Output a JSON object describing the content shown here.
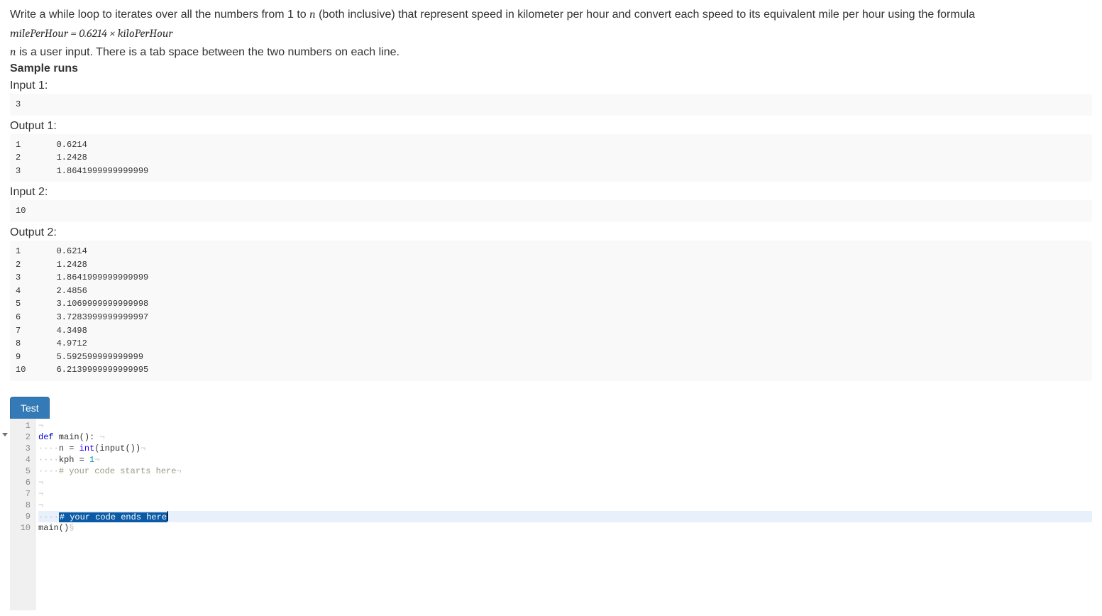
{
  "problem": {
    "line1_prefix": "Write a while loop to iterates over all the numbers from 1 to ",
    "var_n": "n",
    "line1_suffix": " (both inclusive) that represent speed in kilometer per hour and convert each speed to its equivalent mile per hour using the formula",
    "formula": "milePerHour = 0.6214 × kiloPerHour",
    "line3_prefix_n": "n",
    "line3_rest": " is a user input. There is a tab space between the two numbers on each line.",
    "sample_runs_label": "Sample runs",
    "input1_label": "Input 1:",
    "input1": "3",
    "output1_label": "Output 1:",
    "output1": "1\t0.6214\n2\t1.2428\n3\t1.8641999999999999",
    "input2_label": "Input 2:",
    "input2": "10",
    "output2_label": "Output 2:",
    "output2": "1\t0.6214\n2\t1.2428\n3\t1.8641999999999999\n4\t2.4856\n5\t3.1069999999999998\n6\t3.7283999999999997\n7\t4.3498\n8\t4.9712\n9\t5.592599999999999\n10\t6.2139999999999995"
  },
  "tabs": {
    "test": "Test"
  },
  "editor": {
    "lines": [
      {
        "num": "1",
        "kind": "blank"
      },
      {
        "num": "2",
        "kind": "def",
        "fold": true
      },
      {
        "num": "3",
        "kind": "assign_input"
      },
      {
        "num": "4",
        "kind": "assign_kph"
      },
      {
        "num": "5",
        "kind": "comment_start"
      },
      {
        "num": "6",
        "kind": "blank"
      },
      {
        "num": "7",
        "kind": "blank"
      },
      {
        "num": "8",
        "kind": "blank"
      },
      {
        "num": "9",
        "kind": "comment_end_active"
      },
      {
        "num": "10",
        "kind": "call_main"
      }
    ],
    "tokens": {
      "def": "def",
      "main_sig": " main():",
      "n_eq": "n = ",
      "int": "int",
      "input_call": "(input())",
      "kph_eq": "kph = ",
      "one": "1",
      "comment_start": "# your code starts here",
      "comment_end": "# your code ends here",
      "main_call": "main()",
      "indent_dots": "····"
    }
  }
}
